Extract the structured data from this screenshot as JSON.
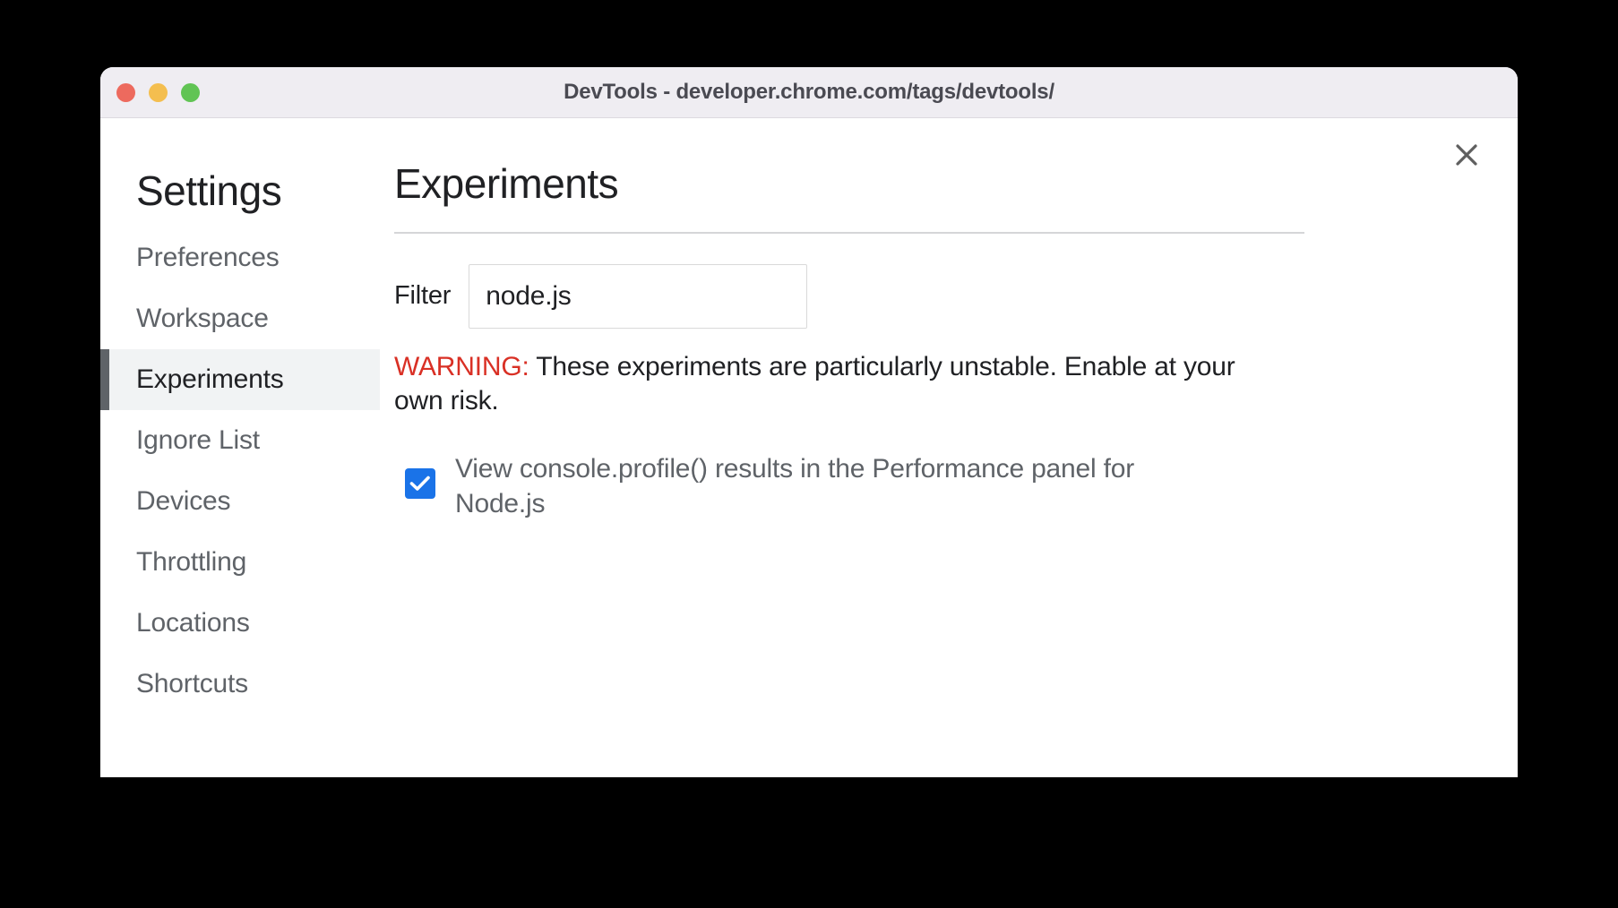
{
  "window": {
    "title": "DevTools - developer.chrome.com/tags/devtools/",
    "traffic_lights": {
      "close_color": "#ED6A5E",
      "minimize_color": "#F4BE4F",
      "zoom_color": "#61C454"
    }
  },
  "dialog": {
    "close_icon": "close-icon"
  },
  "sidebar": {
    "title": "Settings",
    "items": [
      {
        "label": "Preferences",
        "selected": false
      },
      {
        "label": "Workspace",
        "selected": false
      },
      {
        "label": "Experiments",
        "selected": true
      },
      {
        "label": "Ignore List",
        "selected": false
      },
      {
        "label": "Devices",
        "selected": false
      },
      {
        "label": "Throttling",
        "selected": false
      },
      {
        "label": "Locations",
        "selected": false
      },
      {
        "label": "Shortcuts",
        "selected": false
      }
    ]
  },
  "main": {
    "title": "Experiments",
    "filter": {
      "label": "Filter",
      "value": "node.js",
      "placeholder": "Filter"
    },
    "warning": {
      "label": "WARNING:",
      "text": " These experiments are particularly unstable. Enable at your own risk.",
      "color": "#D93025"
    },
    "experiments": [
      {
        "label": "View console.profile() results in the Performance panel for Node.js",
        "checked": true,
        "accent_color": "#1A73E8"
      }
    ]
  }
}
